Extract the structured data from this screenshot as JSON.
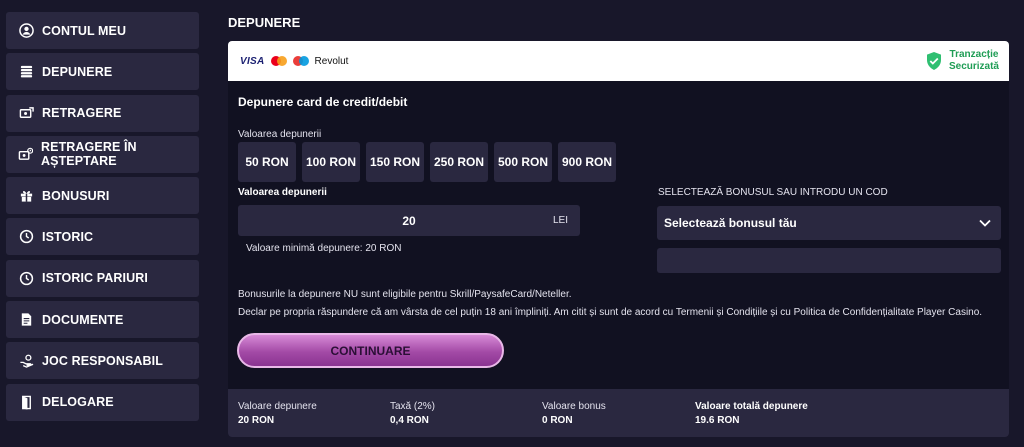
{
  "sidebar": {
    "items": [
      {
        "label": "CONTUL MEU",
        "icon": "user-icon"
      },
      {
        "label": "DEPUNERE",
        "icon": "coins-icon"
      },
      {
        "label": "RETRAGERE",
        "icon": "withdraw-icon"
      },
      {
        "label": "RETRAGERE ÎN AȘTEPTARE",
        "icon": "pending-withdraw-icon"
      },
      {
        "label": "BONUSURI",
        "icon": "gift-icon"
      },
      {
        "label": "ISTORIC",
        "icon": "history-icon"
      },
      {
        "label": "ISTORIC PARIURI",
        "icon": "bet-history-icon"
      },
      {
        "label": "DOCUMENTE",
        "icon": "document-icon"
      },
      {
        "label": "JOC RESPONSABIL",
        "icon": "hand-icon"
      },
      {
        "label": "DELOGARE",
        "icon": "logout-icon"
      }
    ]
  },
  "page": {
    "title": "DEPUNERE"
  },
  "payment_header": {
    "logos": {
      "visa": "VISA",
      "revolut": "Revolut"
    },
    "secure_line1": "Tranzacție",
    "secure_line2": "Securizată"
  },
  "form": {
    "section_title": "Depunere card de credit/debit",
    "amount_label": "Valoarea depunerii",
    "amount_options": [
      "50 RON",
      "100 RON",
      "150 RON",
      "250 RON",
      "500 RON",
      "900 RON"
    ],
    "amount_input_label": "Valoarea depunerii",
    "amount_value": "20",
    "currency": "LEI",
    "min_note": "Valoare minimă depunere: 20 RON",
    "bonus_label": "SELECTEAZĂ BONUSUL SAU INTRODU UN COD",
    "bonus_select": "Selectează bonusul tău",
    "bonus_code_value": "",
    "note_bonus": "Bonusurile la depunere NU sunt eligibile pentru Skrill/PaysafeCard/Neteller.",
    "note_declaration": "Declar pe propria răspundere că am vârsta de cel puțin 18 ani împliniți. Am citit și sunt de acord cu Termenii și Condițiile și cu Politica de Confidențialitate Player Casino.",
    "continue_label": "CONTINUARE"
  },
  "summary": {
    "deposit_label": "Valoare depunere",
    "deposit_value": "20 RON",
    "fee_label": "Taxă (2%)",
    "fee_value": "0,4 RON",
    "bonus_label": "Valoare bonus",
    "bonus_value": "0 RON",
    "total_label": "Valoare totală depunere",
    "total_value": "19.6 RON"
  },
  "colors": {
    "background": "#18172a",
    "panel": "#111121",
    "tile": "#2a2840",
    "accent": "#a34aa6",
    "secure_green": "#1f9d55"
  }
}
